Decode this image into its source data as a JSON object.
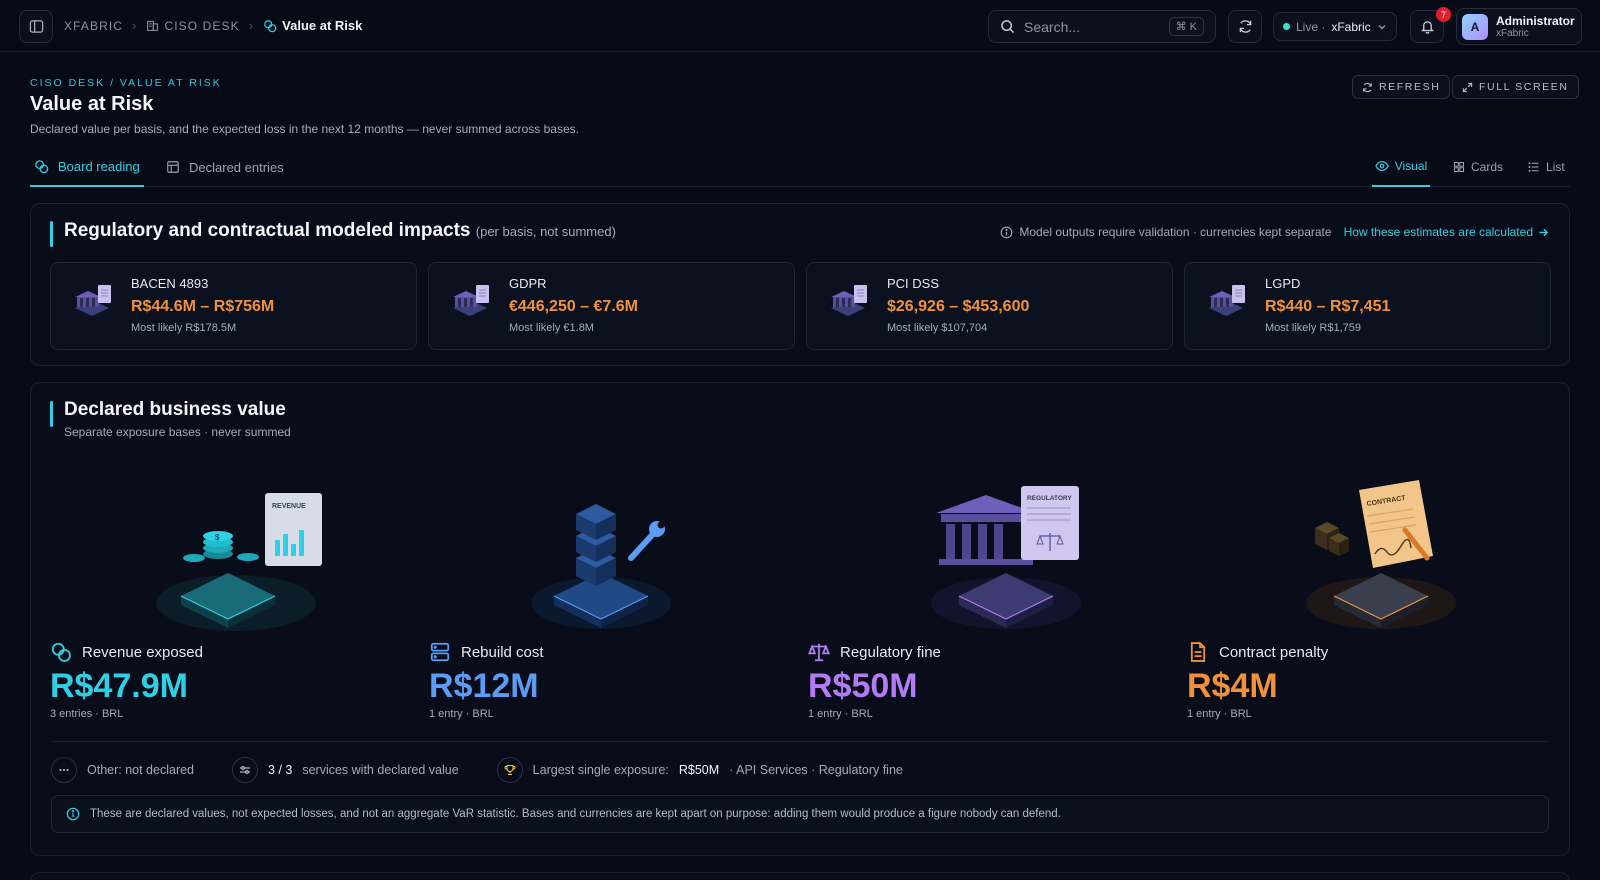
{
  "topbar": {
    "crumbs": [
      "XFABRIC",
      "CISO DESK",
      "Value at Risk"
    ],
    "search_placeholder": "Search...",
    "search_shortcut": "⌘ K",
    "live_label": "Live ·",
    "live_env": "xFabric",
    "notifications_count": "7",
    "user_initial": "A",
    "user_name": "Administrator",
    "user_org": "xFabric"
  },
  "header": {
    "eyebrow": "CISO DESK / VALUE AT RISK",
    "title": "Value at Risk",
    "subtitle": "Declared value per basis, and the expected loss in the next 12 months — never summed across bases.",
    "refresh_label": "REFRESH",
    "fullscreen_label": "FULL SCREEN"
  },
  "tabs": {
    "board": "Board reading",
    "entries": "Declared entries",
    "visual": "Visual",
    "cards": "Cards",
    "list": "List"
  },
  "regulatory": {
    "title": "Regulatory and contractual modeled impacts",
    "title_note": "(per basis, not summed)",
    "note": "Model outputs require validation · currencies kept separate",
    "link": "How these estimates are calculated",
    "cards": [
      {
        "name": "BACEN 4893",
        "range": "R$44.6M – R$756M",
        "likely": "Most likely R$178.5M"
      },
      {
        "name": "GDPR",
        "range": "€446,250 – €7.6M",
        "likely": "Most likely €1.8M"
      },
      {
        "name": "PCI DSS",
        "range": "$26,926 – $453,600",
        "likely": "Most likely $107,704"
      },
      {
        "name": "LGPD",
        "range": "R$440 – R$7,451",
        "likely": "Most likely R$1,759"
      }
    ]
  },
  "business": {
    "title": "Declared business value",
    "subtitle": "Separate exposure bases · never summed",
    "illustration_labels": {
      "revenue": "REVENUE",
      "regulatory": "REGULATORY",
      "contract": "CONTRACT"
    },
    "metrics": [
      {
        "label": "Revenue exposed",
        "value": "R$47.9M",
        "sub": "3 entries · BRL",
        "color": "#2fd0e6"
      },
      {
        "label": "Rebuild cost",
        "value": "R$12M",
        "sub": "1 entry · BRL",
        "color": "#5b9cf5"
      },
      {
        "label": "Regulatory fine",
        "value": "R$50M",
        "sub": "1 entry · BRL",
        "color": "#b47cf4"
      },
      {
        "label": "Contract penalty",
        "value": "R$4M",
        "sub": "1 entry · BRL",
        "color": "#f0923c"
      }
    ],
    "stats": {
      "other": "Other: not declared",
      "services_count": "3 / 3",
      "services_label": "services with declared value",
      "largest_label": "Largest single exposure:",
      "largest_value": "R$50M",
      "largest_source": "· API Services · Regulatory fine"
    },
    "info": "These are declared values, not expected losses, and not an aggregate VaR statistic. Bases and currencies are kept apart on purpose: adding them would produce a figure nobody can defend."
  }
}
